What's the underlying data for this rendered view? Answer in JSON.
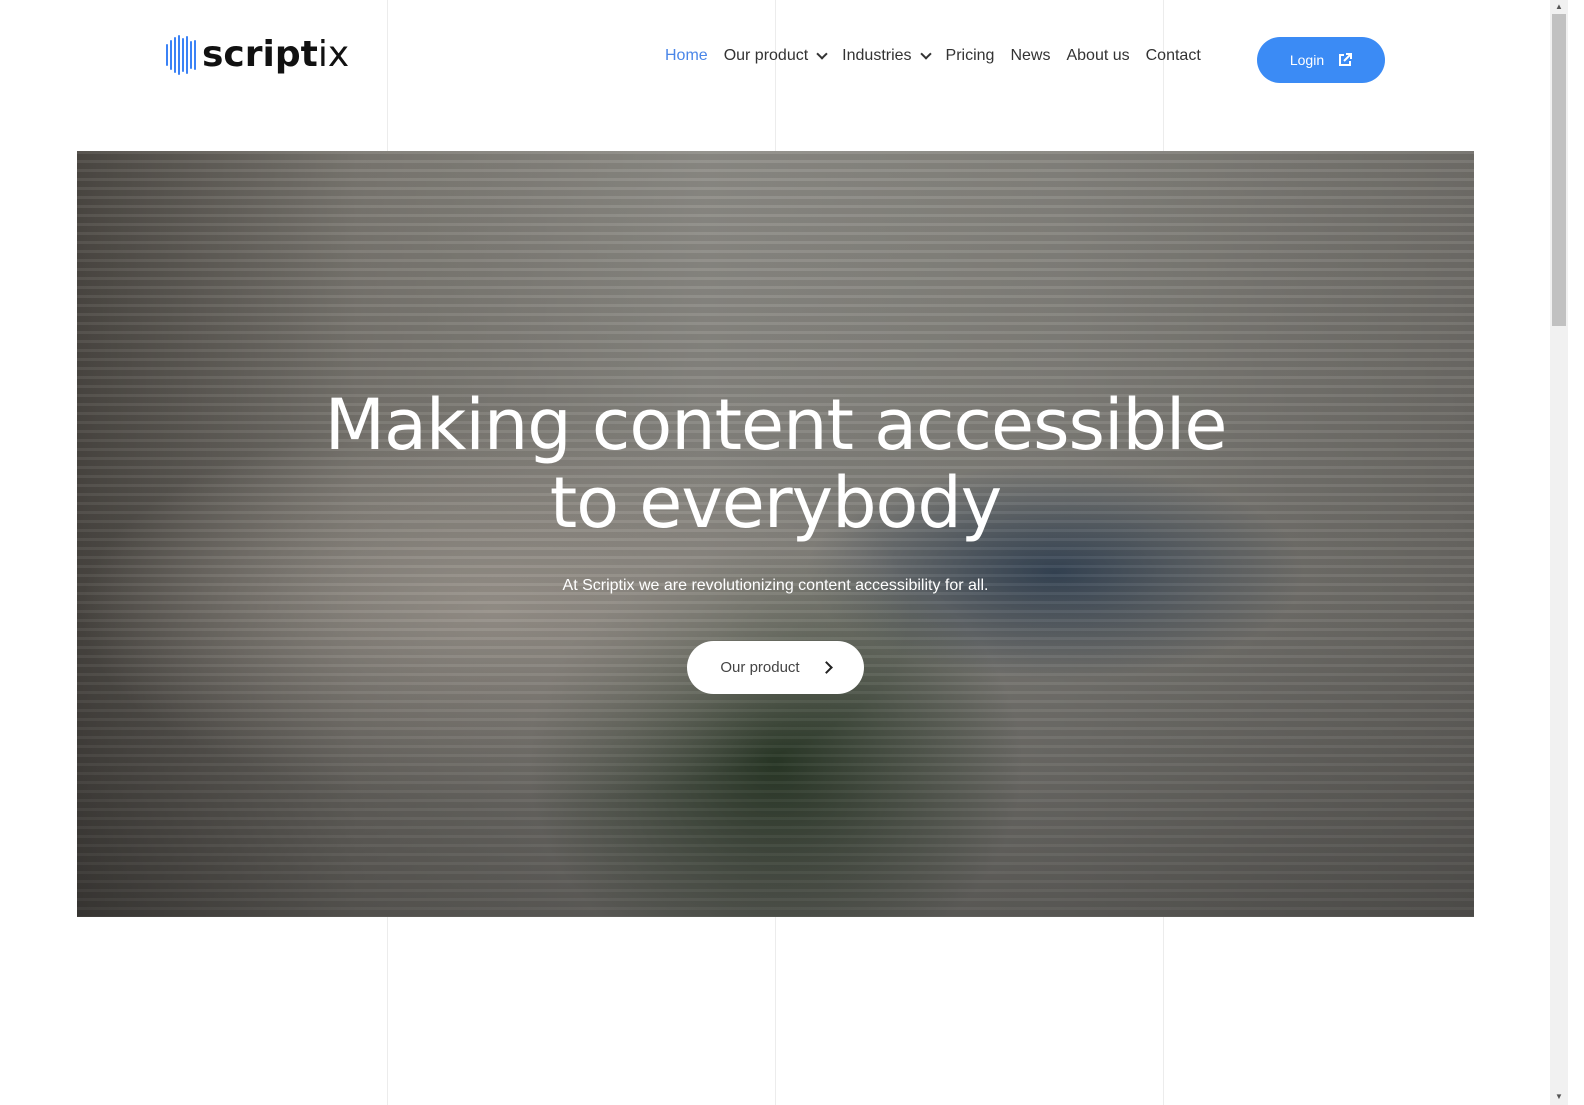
{
  "brand": {
    "name": "scriptix",
    "accent": "#3b8bf5"
  },
  "nav": {
    "items": [
      {
        "label": "Home",
        "active": true
      },
      {
        "label": "Our product",
        "dropdown": true
      },
      {
        "label": "Industries",
        "dropdown": true
      },
      {
        "label": "Pricing"
      },
      {
        "label": "News"
      },
      {
        "label": "About us"
      },
      {
        "label": "Contact"
      }
    ]
  },
  "login": {
    "label": "Login",
    "icon": "external-link-icon"
  },
  "hero": {
    "title": "Making content accessible to everybody",
    "subtitle": "At Scriptix we are revolutionizing content accessibility for all.",
    "cta": "Our product"
  }
}
